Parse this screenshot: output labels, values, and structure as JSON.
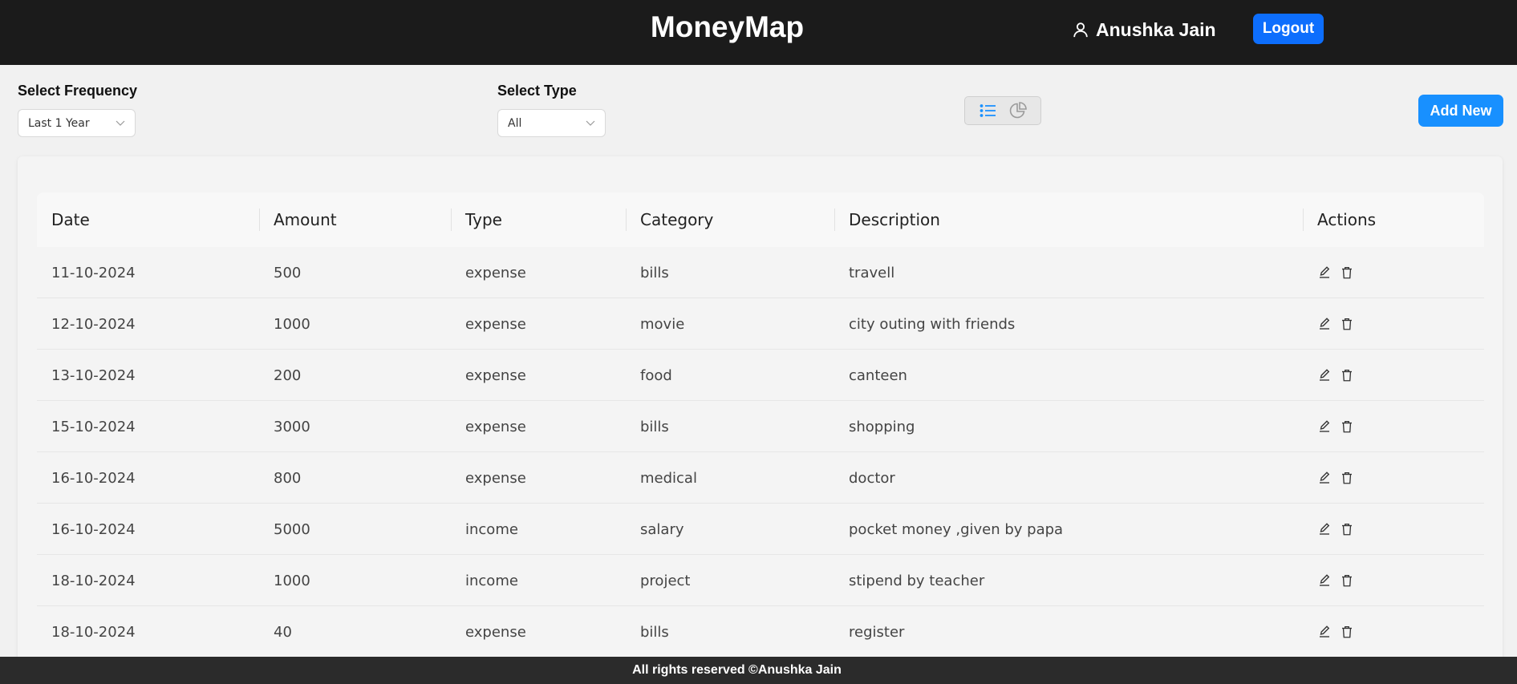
{
  "header": {
    "brand": "MoneyMap",
    "user_name": "Anushka Jain",
    "logout_label": "Logout"
  },
  "filters": {
    "frequency_label": "Select Frequency",
    "frequency_value": "Last 1 Year",
    "type_label": "Select Type",
    "type_value": "All"
  },
  "toolbar": {
    "view_icons": [
      "list-icon",
      "pie-chart-icon"
    ],
    "active_view": "list",
    "add_new_label": "Add New"
  },
  "table": {
    "columns": [
      "Date",
      "Amount",
      "Type",
      "Category",
      "Description",
      "Actions"
    ],
    "rows": [
      {
        "date": "11-10-2024",
        "amount": "500",
        "type": "expense",
        "category": "bills",
        "description": "travell"
      },
      {
        "date": "12-10-2024",
        "amount": "1000",
        "type": "expense",
        "category": "movie",
        "description": "city outing with friends"
      },
      {
        "date": "13-10-2024",
        "amount": "200",
        "type": "expense",
        "category": "food",
        "description": "canteen"
      },
      {
        "date": "15-10-2024",
        "amount": "3000",
        "type": "expense",
        "category": "bills",
        "description": "shopping"
      },
      {
        "date": "16-10-2024",
        "amount": "800",
        "type": "expense",
        "category": "medical",
        "description": "doctor"
      },
      {
        "date": "16-10-2024",
        "amount": "5000",
        "type": "income",
        "category": "salary",
        "description": "pocket money ,given by papa"
      },
      {
        "date": "18-10-2024",
        "amount": "1000",
        "type": "income",
        "category": "project",
        "description": "stipend by teacher"
      },
      {
        "date": "18-10-2024",
        "amount": "40",
        "type": "expense",
        "category": "bills",
        "description": "register"
      }
    ]
  },
  "footer": {
    "text": "All rights reserved ©Anushka Jain"
  },
  "colors": {
    "navbar": "#1b1b1b",
    "logout_button": "#0d6efd",
    "add_new_button": "#1890ff",
    "active_view_icon": "#1890ff",
    "footer": "#2b2b2b"
  }
}
